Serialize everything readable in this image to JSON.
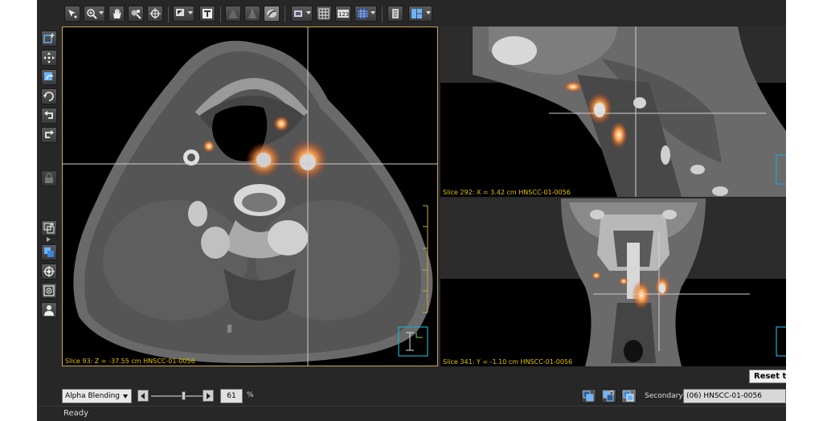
{
  "views": {
    "axial_caption": "Slice 93: Z = -37.55 cm HNSCC-01-0056",
    "sagittal_caption": "Slice 292: X = 3.42 cm HNSCC-01-0056",
    "coronal_caption": "Slice 341: Y = -1.10 cm HNSCC-01-0056"
  },
  "reset_label": "Reset to",
  "fusion": {
    "mode": "Alpha Blending",
    "opacity_value": "61",
    "opacity_fraction": 0.61,
    "percent_sign": "%"
  },
  "secondary": {
    "label": "Secondary",
    "value": "(06) HNSCC-01-0056"
  },
  "status": "Ready",
  "colors": {
    "accent_border": "#c9a84a",
    "caption": "#e6c200",
    "orientation_marker": "#22a8c8",
    "pet_hotspot": "#e07020"
  },
  "icons": {
    "toolbar": [
      "pointer-icon",
      "zoom-icon",
      "pan-hand-icon",
      "window-level-icon",
      "crosshair-icon",
      "annotate-icon",
      "text-icon",
      "volume-render-icon",
      "mip-icon",
      "contour-icon",
      "screenshot-icon",
      "grid-icon",
      "numbers-icon",
      "colormap-icon",
      "series-icon",
      "layout-icon"
    ],
    "sidebar": [
      "add-roi-icon",
      "move-icon",
      "rotate-image-icon",
      "reset-icon",
      "undo-icon",
      "redo-icon",
      "lock-icon",
      "overlay-icon",
      "sync-icon",
      "target-icon",
      "crosshair-center-icon",
      "patient-icon"
    ],
    "fusion": [
      "fusion-primary-icon",
      "fusion-blend-icon",
      "fusion-secondary-icon"
    ]
  }
}
